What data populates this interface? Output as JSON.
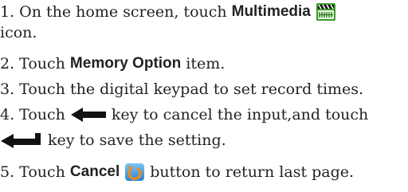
{
  "steps": [
    {
      "a": "1. On the home screen, touch",
      "bold": "Multimedia",
      "b": "",
      "cont": "icon."
    },
    {
      "a": "2. Touch",
      "bold": "Memory Option",
      "b": "item."
    },
    {
      "a": "3. Touch the digital keypad to set record times."
    },
    {
      "a": "4. Touch",
      "b": "key to cancel the input,and touch",
      "cont": "key to save the setting."
    },
    {
      "a": "5. Touch",
      "bold": "Cancel",
      "b": "button to return last page."
    }
  ],
  "icons": {
    "multimedia": "multimedia-clapperboard-icon",
    "backspace": "backspace-arrow-icon",
    "save": "save-arrow-icon",
    "cancel": "cancel-return-icon"
  },
  "colors": {
    "text": "#222222",
    "multimedia_green": "#3a9a2a",
    "cancel_orange": "#f08a20",
    "cancel_blue": "#4aa3e0"
  }
}
